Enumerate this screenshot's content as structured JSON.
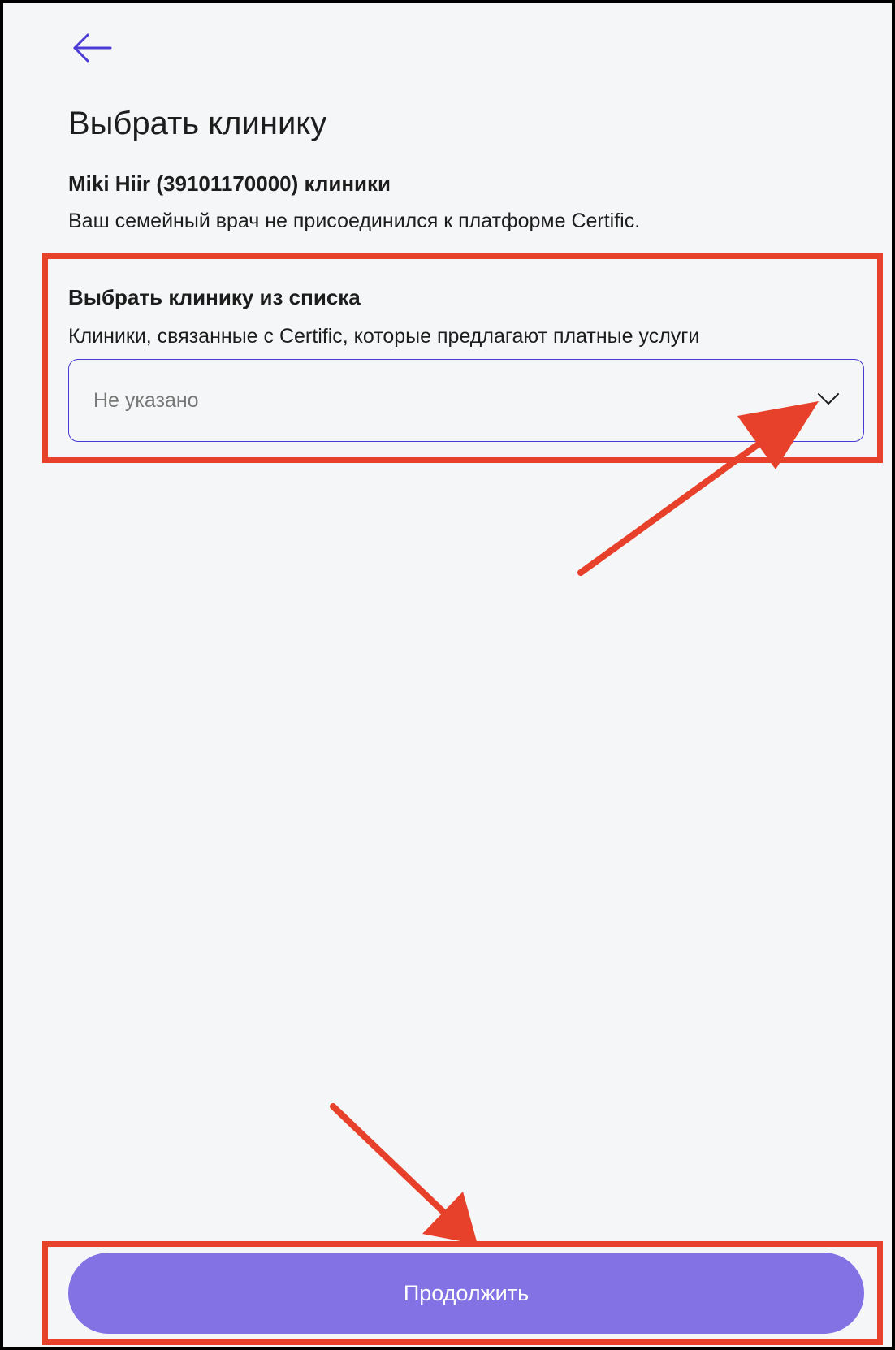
{
  "header": {
    "back_icon": "arrow-left-icon",
    "title": "Выбрать клинику"
  },
  "info": {
    "owner": "Miki Hiir (39101170000) клиники",
    "notice": "Ваш семейный врач не присоединился к платформе Certific."
  },
  "clinic_select": {
    "title": "Выбрать клинику из списка",
    "description": "Клиники, связанные с Certific, которые предлагают платные услуги",
    "value": "Не указано",
    "icon": "chevron-down-icon"
  },
  "footer": {
    "continue_label": "Продолжить"
  },
  "colors": {
    "accent": "#4a3bd6",
    "button": "#8272e4",
    "annotation": "#e8412b",
    "background": "#f5f6f7"
  }
}
